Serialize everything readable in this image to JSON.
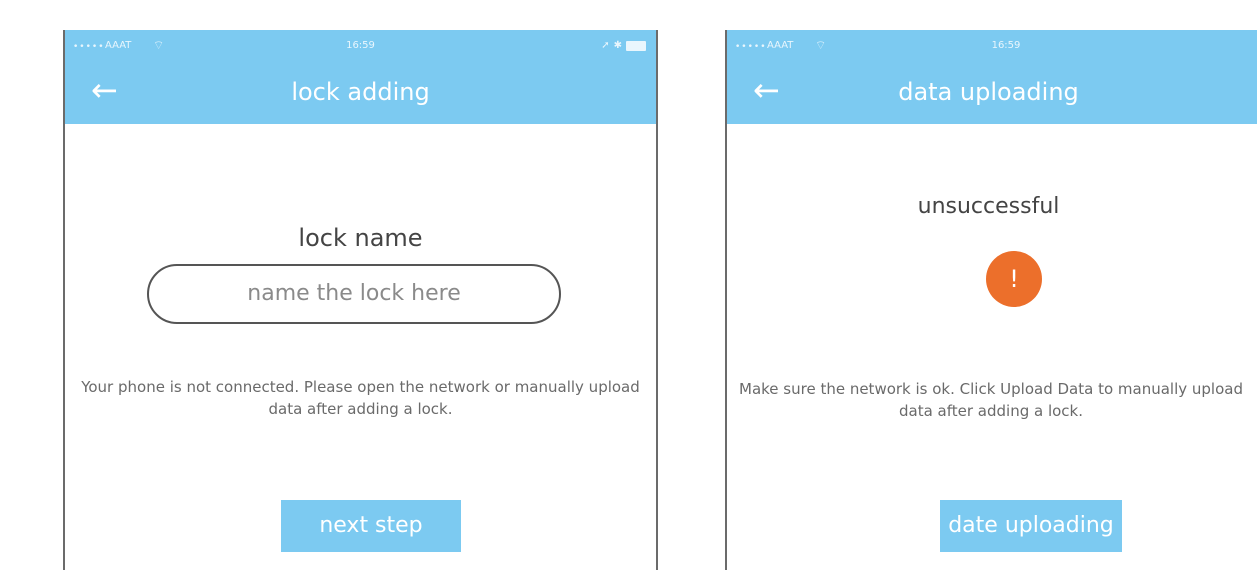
{
  "left_screen": {
    "status_bar": {
      "signal_dots": "•••••",
      "carrier": "AAAT",
      "time": "16:59"
    },
    "header": {
      "title": "lock adding"
    },
    "lock_name_label": "lock name",
    "name_input": {
      "placeholder": "name the lock here"
    },
    "note": "Your phone is not connected. Please open the network or manually upload data after adding a lock.",
    "next_button": "next step"
  },
  "right_screen": {
    "status_bar": {
      "signal_dots": "•••••",
      "carrier": "AAAT",
      "time": "16:59"
    },
    "header": {
      "title": "data uploading"
    },
    "status_text": "unsuccessful",
    "alert_symbol": "!",
    "note": "Make sure the network is ok. Click Upload Data to manually upload data after adding a lock.",
    "upload_button": "date uploading"
  },
  "colors": {
    "accent": "#7ccaf1",
    "alert": "#ec6f2b"
  },
  "icons": [
    "back-arrow-icon",
    "wifi-icon",
    "bluetooth-icon",
    "battery-icon",
    "alert-icon"
  ]
}
